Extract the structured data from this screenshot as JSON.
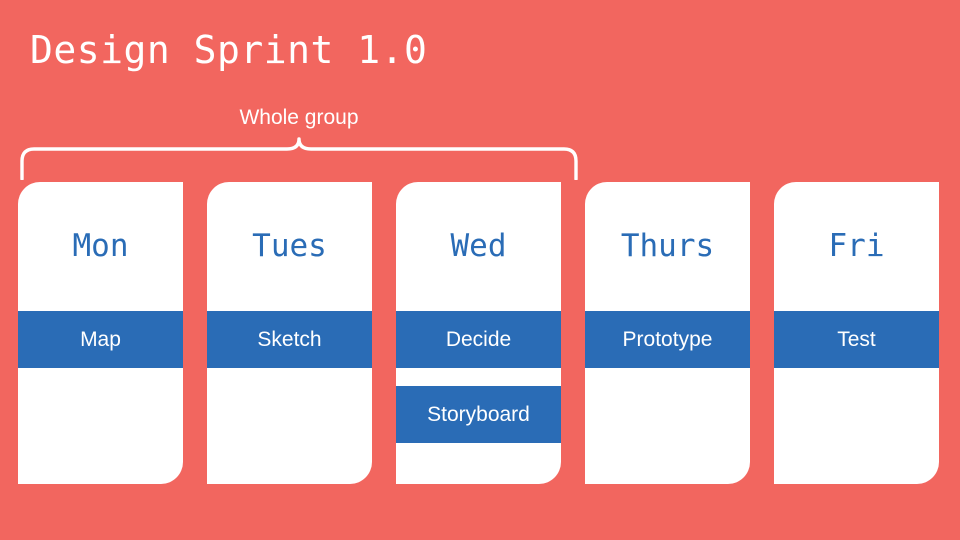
{
  "slide": {
    "title": "Design Sprint 1.0",
    "background_color": "#f2665f",
    "accent_color": "#2a6cb6",
    "card_color": "#ffffff",
    "text_on_accent_color": "#ffffff"
  },
  "annotation": {
    "label": "Whole group",
    "icon": "curly-brace-down"
  },
  "schedule": {
    "days": [
      {
        "day": "Mon",
        "tasks": [
          {
            "label": "Map"
          }
        ]
      },
      {
        "day": "Tues",
        "tasks": [
          {
            "label": "Sketch"
          }
        ]
      },
      {
        "day": "Wed",
        "tasks": [
          {
            "label": "Decide"
          },
          {
            "label": "Storyboard"
          }
        ]
      },
      {
        "day": "Thurs",
        "tasks": [
          {
            "label": "Prototype"
          }
        ]
      },
      {
        "day": "Fri",
        "tasks": [
          {
            "label": "Test"
          }
        ]
      }
    ]
  }
}
